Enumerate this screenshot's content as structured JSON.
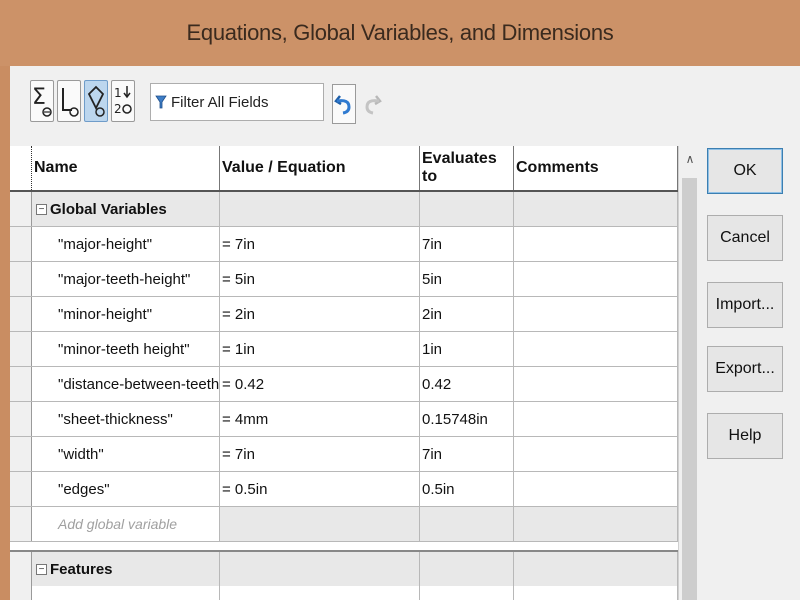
{
  "window": {
    "title": "Equations, Global Variables, and Dimensions"
  },
  "toolbar": {
    "buttons": [
      {
        "name": "equation-view-icon",
        "active": false
      },
      {
        "name": "sketch-equation-view-icon",
        "active": false
      },
      {
        "name": "dimension-view-icon",
        "active": true
      },
      {
        "name": "ordered-view-icon",
        "active": false
      }
    ],
    "filter_value": "Filter All Fields"
  },
  "table": {
    "columns": [
      "Name",
      "Value / Equation",
      "Evaluates to",
      "Comments"
    ],
    "groups": [
      {
        "label": "Global Variables",
        "rows": [
          {
            "name": "\"major-height\"",
            "value": "= 7in",
            "evaluates": "7in",
            "comment": ""
          },
          {
            "name": "\"major-teeth-height\"",
            "value": "= 5in",
            "evaluates": "5in",
            "comment": ""
          },
          {
            "name": "\"minor-height\"",
            "value": "= 2in",
            "evaluates": "2in",
            "comment": ""
          },
          {
            "name": "\"minor-teeth height\"",
            "value": "= 1in",
            "evaluates": "1in",
            "comment": ""
          },
          {
            "name": "\"distance-between-teeth\"",
            "value": "= 0.42",
            "evaluates": "0.42",
            "comment": ""
          },
          {
            "name": "\"sheet-thickness\"",
            "value": "= 4mm",
            "evaluates": "0.15748in",
            "comment": ""
          },
          {
            "name": "\"width\"",
            "value": "= 7in",
            "evaluates": "7in",
            "comment": ""
          },
          {
            "name": "\"edges\"",
            "value": "= 0.5in",
            "evaluates": "0.5in",
            "comment": ""
          }
        ],
        "add_label": "Add global variable"
      },
      {
        "label": "Features"
      }
    ]
  },
  "buttons": {
    "ok": "OK",
    "cancel": "Cancel",
    "import": "Import...",
    "export": "Export...",
    "help": "Help"
  },
  "colors": {
    "title_bar": "#cc9268",
    "active_tool": "#bcd6ee"
  }
}
